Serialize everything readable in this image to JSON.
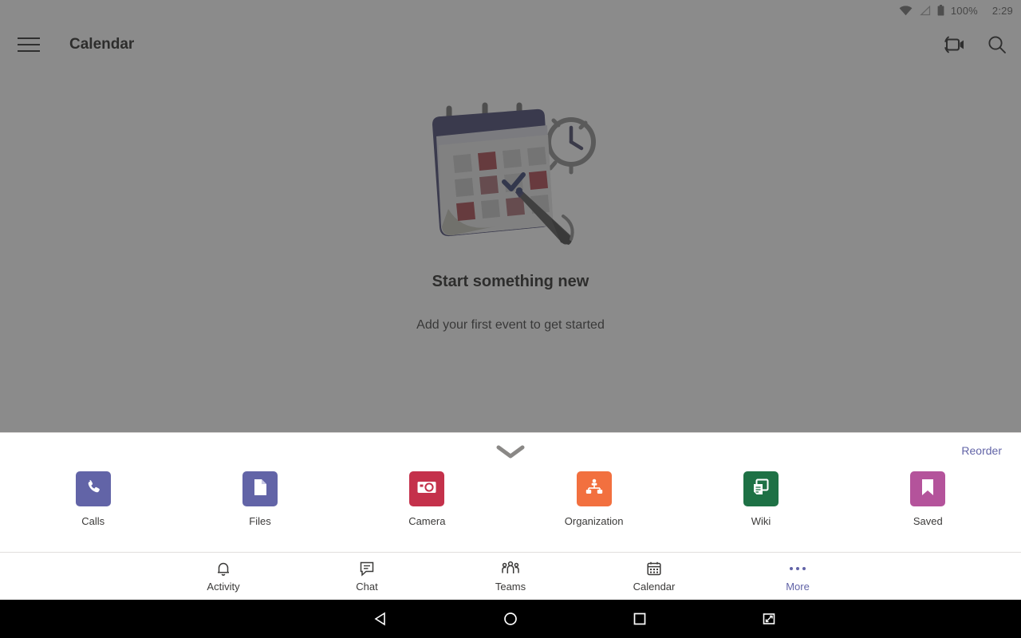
{
  "status_bar": {
    "battery_percent": "100%",
    "clock": "2:29",
    "icons": [
      "wifi-icon",
      "cellular-signal-icon",
      "battery-icon"
    ]
  },
  "app_bar": {
    "menu_icon": "hamburger-menu-icon",
    "title": "Calendar",
    "actions": [
      {
        "name": "meet-now-icon",
        "label": "Meet now"
      },
      {
        "name": "search-icon",
        "label": "Search"
      }
    ]
  },
  "empty_state": {
    "illustration": "calendar-with-pen-and-clock-illustration",
    "title": "Start something new",
    "subtitle": "Add your first event to get started"
  },
  "drawer": {
    "handle_icon": "chevron-down-icon",
    "reorder_label": "Reorder",
    "apps": [
      {
        "label": "Calls",
        "icon": "phone-icon",
        "color": "#6264a7"
      },
      {
        "label": "Files",
        "icon": "file-icon",
        "color": "#6264a7"
      },
      {
        "label": "Camera",
        "icon": "camera-icon",
        "color": "#c4314b"
      },
      {
        "label": "Organization",
        "icon": "org-chart-icon",
        "color": "#f2703f"
      },
      {
        "label": "Wiki",
        "icon": "wiki-pages-icon",
        "color": "#1e7145"
      },
      {
        "label": "Saved",
        "icon": "bookmark-icon",
        "color": "#b4539b"
      }
    ]
  },
  "bottom_nav": {
    "active": "More",
    "accent_color": "#6264a7",
    "items": [
      {
        "label": "Activity",
        "icon": "bell-icon",
        "active": false
      },
      {
        "label": "Chat",
        "icon": "chat-icon",
        "active": false
      },
      {
        "label": "Teams",
        "icon": "teams-icon",
        "active": false
      },
      {
        "label": "Calendar",
        "icon": "calendar-icon",
        "active": false
      },
      {
        "label": "More",
        "icon": "ellipsis-icon",
        "active": true
      }
    ]
  },
  "android_nav": {
    "buttons": [
      {
        "name": "back-button",
        "icon": "triangle-left-icon"
      },
      {
        "name": "home-button",
        "icon": "circle-icon"
      },
      {
        "name": "recents-button",
        "icon": "square-icon"
      },
      {
        "name": "resize-button",
        "icon": "resize-window-icon"
      }
    ]
  },
  "theme": {
    "accent": "#6264a7",
    "scrim": "rgba(55,55,55,0.58)",
    "text_primary": "#201f1e",
    "text_secondary": "#3b3a39"
  }
}
